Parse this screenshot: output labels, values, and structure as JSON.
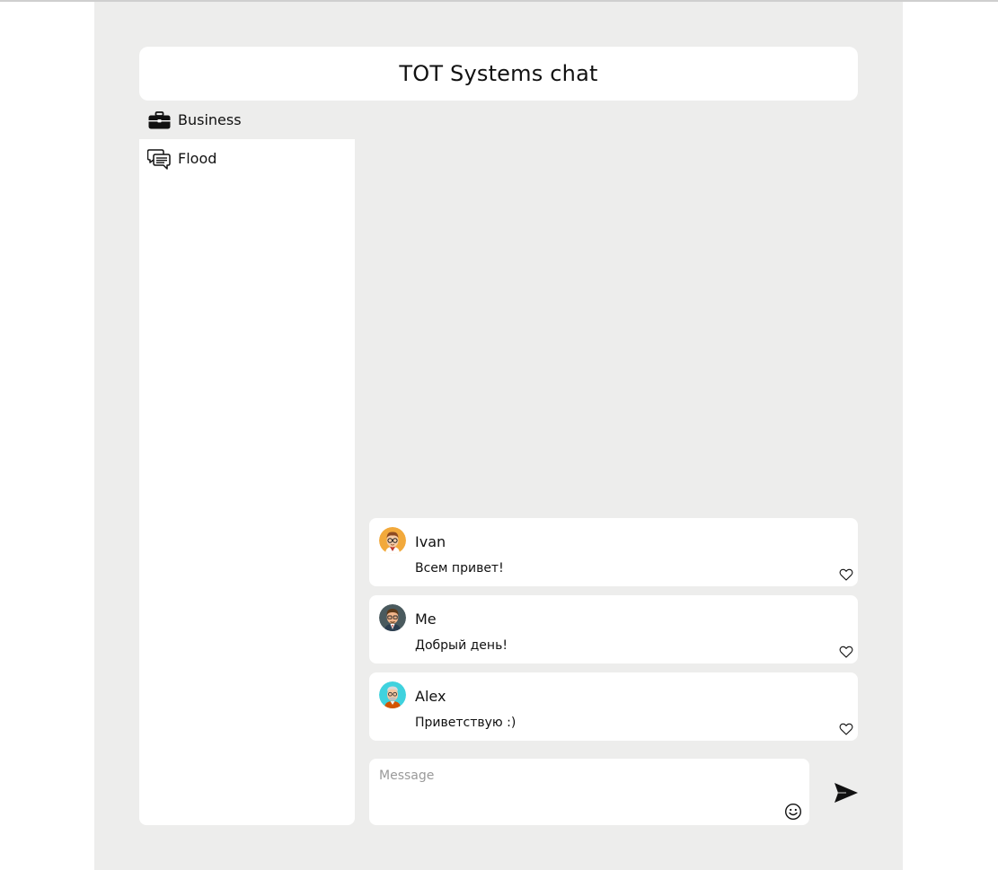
{
  "header": {
    "title": "TOT Systems chat"
  },
  "sidebar": {
    "channels": [
      {
        "label": "Business",
        "icon": "briefcase-icon"
      },
      {
        "label": "Flood",
        "icon": "chat-bubbles-icon"
      }
    ]
  },
  "messages": [
    {
      "author": "Ivan",
      "text": "Всем привет!",
      "avatar": "avatar-ivan",
      "liked": false
    },
    {
      "author": "Me",
      "text": "Добрый день!",
      "avatar": "avatar-me",
      "liked": false
    },
    {
      "author": "Alex",
      "text": "Приветствую :)",
      "avatar": "avatar-alex",
      "liked": false
    }
  ],
  "composer": {
    "placeholder": "Message",
    "value": "",
    "emoji_icon": "smiley-icon",
    "send_icon": "send-icon"
  },
  "colors": {
    "page_background": "#ededec",
    "panel": "#ffffff",
    "text": "#111111",
    "placeholder": "#9a9a9a"
  }
}
